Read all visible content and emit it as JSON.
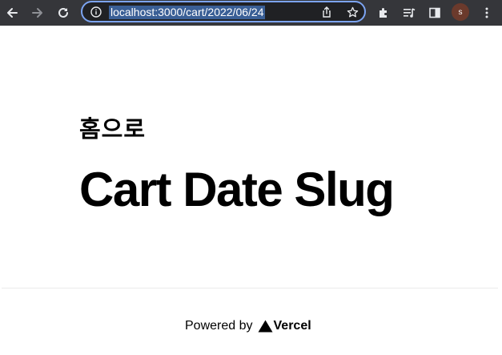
{
  "browser": {
    "url": "localhost:3000/cart/2022/06/24",
    "profile_initial": "s",
    "icons": {
      "back": "back-arrow-icon",
      "forward": "forward-arrow-icon",
      "reload": "reload-icon",
      "site_info": "info-icon",
      "share": "share-icon",
      "bookmark": "star-icon",
      "extensions": "puzzle-icon",
      "media": "media-control-icon",
      "side_panel": "side-panel-icon",
      "menu": "kebab-menu-icon"
    },
    "accent_color": "#7ca4f2",
    "toolbar_color": "#35363a"
  },
  "page": {
    "home_link": "홈으로",
    "title": "Cart Date Slug",
    "footer": {
      "powered_by": "Powered by",
      "brand": "Vercel"
    }
  }
}
